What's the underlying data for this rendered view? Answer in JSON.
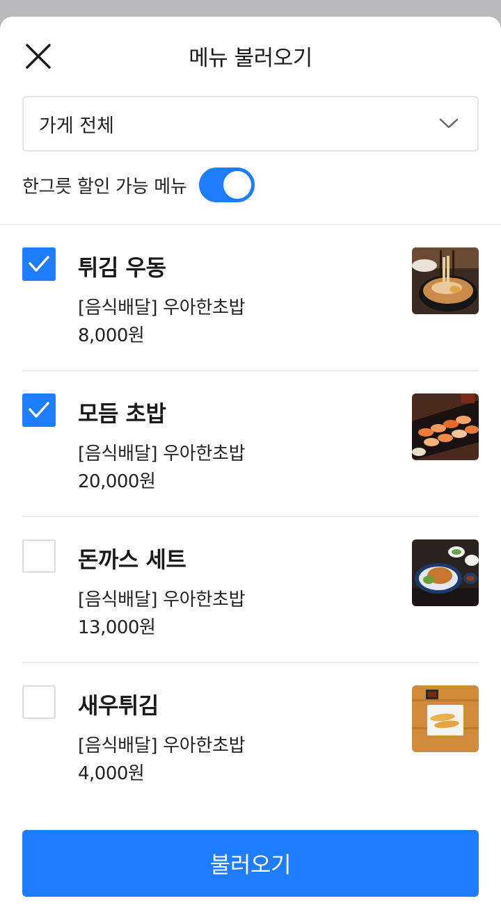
{
  "header": {
    "title": "메뉴 불러오기",
    "close_icon": "close-icon"
  },
  "store_select": {
    "value": "가게 전체",
    "icon": "chevron-down-icon"
  },
  "discount_toggle": {
    "label": "한그릇 할인 가능 메뉴",
    "on": true
  },
  "menu_items": [
    {
      "name": "튀김 우동",
      "store": "[음식배달] 우아한초밥",
      "price": "8,000원",
      "checked": true,
      "photo": "udon"
    },
    {
      "name": "모듬 초밥",
      "store": "[음식배달] 우아한초밥",
      "price": "20,000원",
      "checked": true,
      "photo": "sushi"
    },
    {
      "name": "돈까스 세트",
      "store": "[음식배달] 우아한초밥",
      "price": "13,000원",
      "checked": false,
      "photo": "tonkatsu"
    },
    {
      "name": "새우튀김",
      "store": "[음식배달] 우아한초밥",
      "price": "4,000원",
      "checked": false,
      "photo": "shrimp-tempura"
    }
  ],
  "footer": {
    "submit_label": "불러오기"
  },
  "colors": {
    "accent": "#1e7cff",
    "backdrop": "#b8b9bb"
  }
}
